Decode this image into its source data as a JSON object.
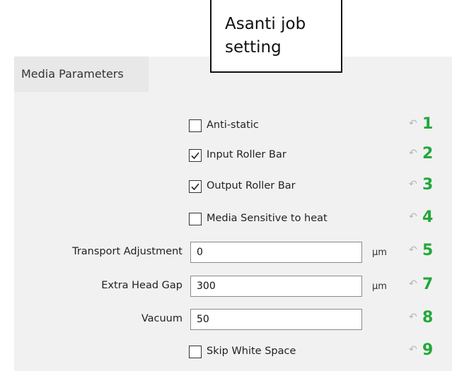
{
  "callout": {
    "line1": "Asanti job",
    "line2": "setting"
  },
  "panel": {
    "title": "Media Parameters"
  },
  "rows": [
    {
      "type": "checkbox",
      "label": "Anti-static",
      "checked": false,
      "number": "1"
    },
    {
      "type": "checkbox",
      "label": "Input Roller Bar",
      "checked": true,
      "number": "2"
    },
    {
      "type": "checkbox",
      "label": "Output Roller Bar",
      "checked": true,
      "number": "3"
    },
    {
      "type": "checkbox",
      "label": "Media Sensitive to heat",
      "checked": false,
      "number": "4"
    },
    {
      "type": "field",
      "label": "Transport Adjustment",
      "value": "0",
      "unit": "µm",
      "number": "5"
    },
    {
      "type": "field",
      "label": "Extra Head Gap",
      "value": "300",
      "unit": "µm",
      "number": "7"
    },
    {
      "type": "field",
      "label": "Vacuum",
      "value": "50",
      "unit": "",
      "number": "8"
    },
    {
      "type": "checkbox",
      "label": "Skip White Space",
      "checked": false,
      "number": "9"
    }
  ],
  "reset_glyph": "↶",
  "colors": {
    "panel_bg": "#f1f1f1",
    "number_green": "#22a83a",
    "reset_gray": "#b5b5b5"
  }
}
